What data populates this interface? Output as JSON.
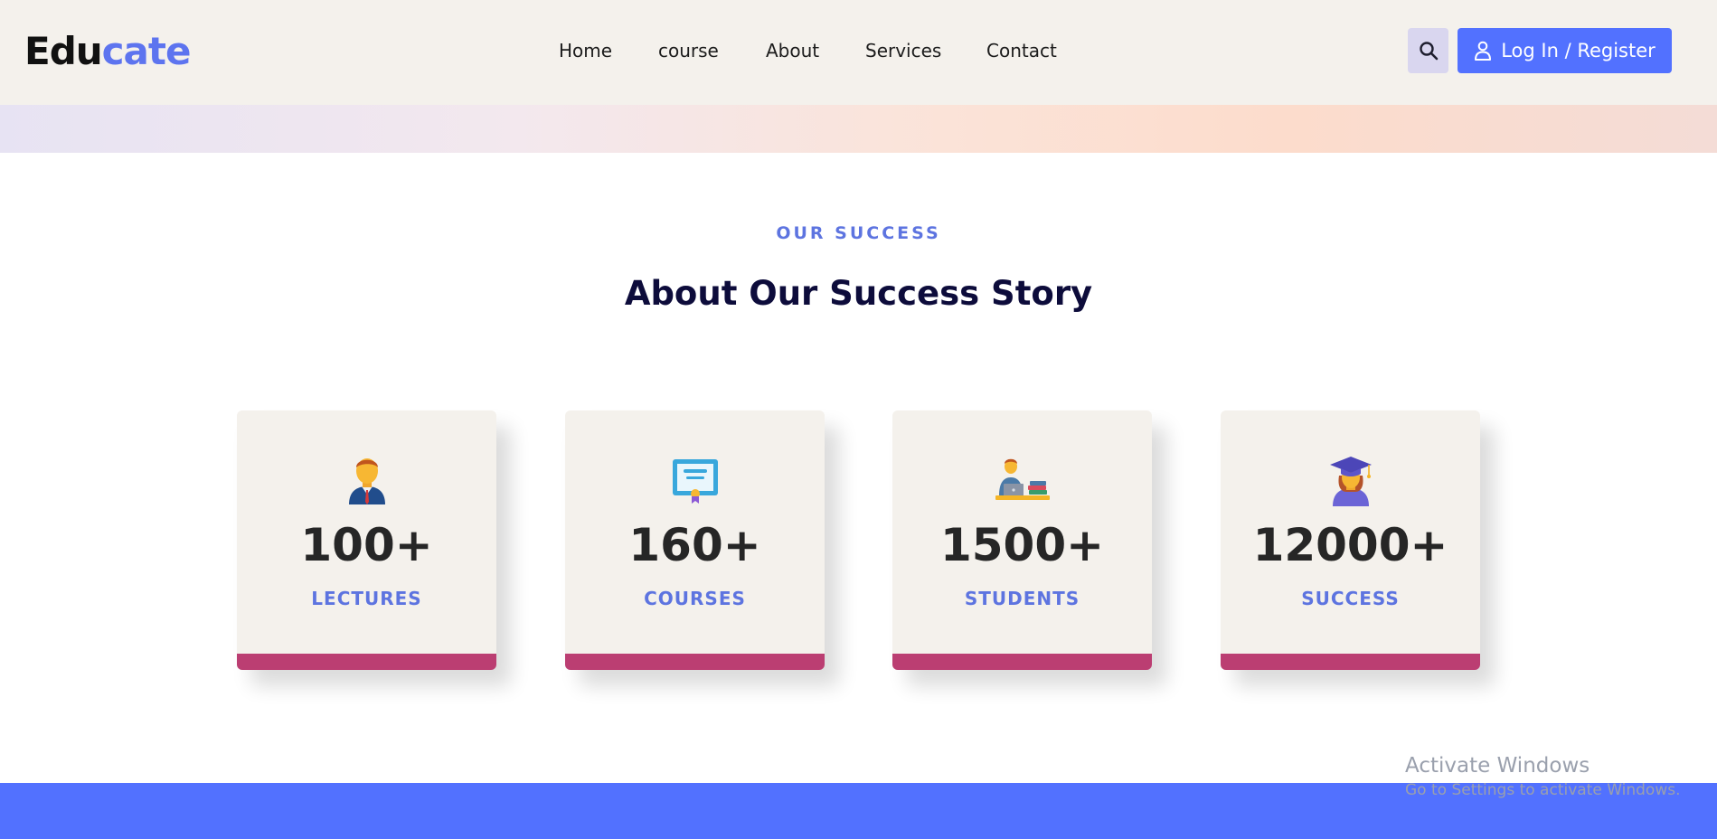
{
  "header": {
    "logo_part1": "Edu",
    "logo_part2": "cate",
    "nav": [
      "Home",
      "course",
      "About",
      "Services",
      "Contact"
    ],
    "login_label": "Log In / Register"
  },
  "section": {
    "subtitle": "OUR SUCCESS",
    "title": "About Our Success Story"
  },
  "stats": [
    {
      "value": "100+",
      "label": "LECTURES",
      "icon": "teacher-icon"
    },
    {
      "value": "160+",
      "label": "COURSES",
      "icon": "certificate-icon"
    },
    {
      "value": "1500+",
      "label": "STUDENTS",
      "icon": "student-laptop-icon"
    },
    {
      "value": "12000+",
      "label": "SUCCESS",
      "icon": "graduate-icon"
    }
  ],
  "watermark": {
    "line1": "Activate Windows",
    "line2": "Go to Settings to activate Windows."
  },
  "colors": {
    "accent": "#5271ff",
    "label_blue": "#5d74e0",
    "card_bar": "#bb3e72",
    "header_bg": "#f4f1ec"
  }
}
